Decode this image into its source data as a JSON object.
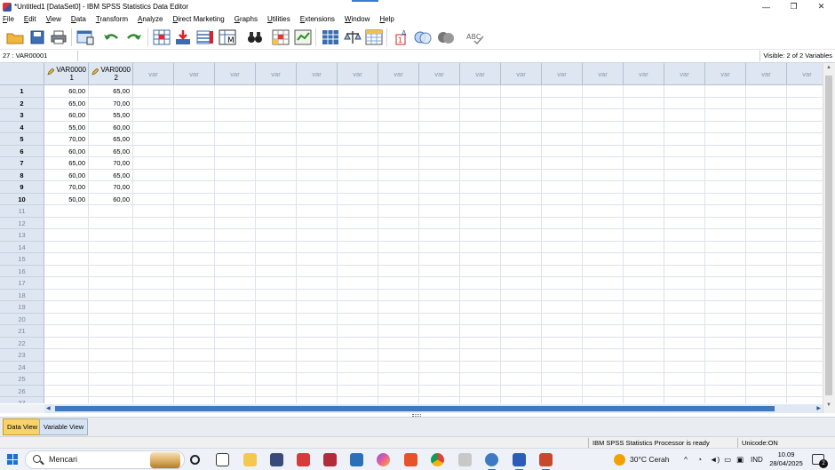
{
  "window": {
    "title": "*Untitled1 [DataSet0] - IBM SPSS Statistics Data Editor",
    "minimize": "—",
    "restore": "❐",
    "close": "✕"
  },
  "menu": [
    "File",
    "Edit",
    "View",
    "Data",
    "Transform",
    "Analyze",
    "Direct Marketing",
    "Graphs",
    "Utilities",
    "Extensions",
    "Window",
    "Help"
  ],
  "refbar": {
    "cell_reference": "27 : VAR00001",
    "visible": "Visible: 2 of 2 Variables"
  },
  "grid": {
    "var1_line1": "VAR0000",
    "var1_line2": "1",
    "var2_line1": "VAR0000",
    "var2_line2": "2",
    "empty_col_label": "var",
    "empty_col_count": 17,
    "rows": [
      [
        "60,00",
        "65,00"
      ],
      [
        "65,00",
        "70,00"
      ],
      [
        "60,00",
        "55,00"
      ],
      [
        "55,00",
        "60,00"
      ],
      [
        "70,00",
        "65,00"
      ],
      [
        "60,00",
        "65,00"
      ],
      [
        "65,00",
        "70,00"
      ],
      [
        "60,00",
        "65,00"
      ],
      [
        "70,00",
        "70,00"
      ],
      [
        "50,00",
        "60,00"
      ]
    ],
    "total_rows": 27
  },
  "tabs": {
    "data_view": "Data View",
    "variable_view": "Variable View"
  },
  "status": {
    "processor": "IBM SPSS Statistics Processor is ready",
    "unicode": "Unicode:ON"
  },
  "taskbar": {
    "search_placeholder": "Mencari",
    "weather": "30°C  Cerah",
    "language": "IND",
    "time": "10.09",
    "date": "28/04/2025",
    "notification_count": "2"
  },
  "colors": {
    "header_bg": "#dde6f1",
    "active_tab": "#f8d36a",
    "scroll_thumb": "#3e78c2"
  }
}
